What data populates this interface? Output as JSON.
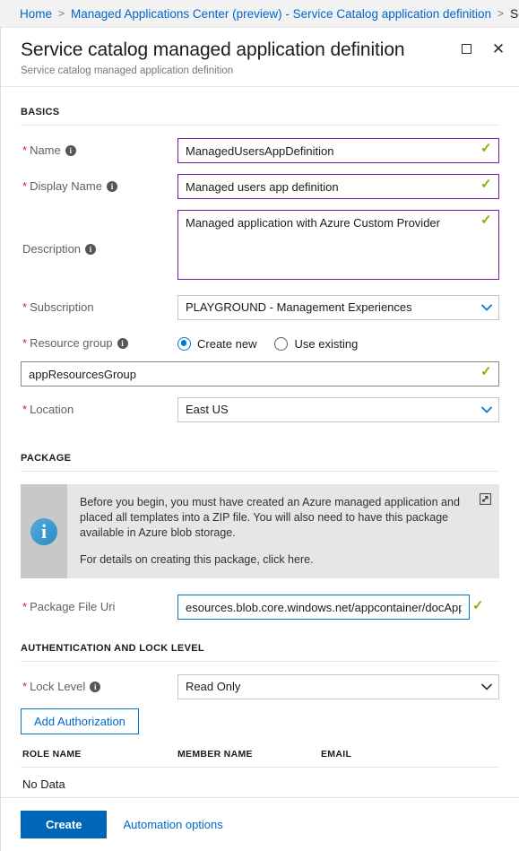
{
  "breadcrumb": {
    "items": [
      {
        "label": "Home"
      },
      {
        "label": "Managed Applications Center (preview) - Service Catalog application definition"
      },
      {
        "label": "Serv"
      }
    ],
    "separator": ">"
  },
  "blade": {
    "title": "Service catalog managed application definition",
    "subtitle": "Service catalog managed application definition",
    "maximize_icon": "maximize-icon",
    "close_icon": "close-icon"
  },
  "sections": {
    "basics": "BASICS",
    "package": "PACKAGE",
    "auth": "AUTHENTICATION AND LOCK LEVEL"
  },
  "fields": {
    "name": {
      "label": "Name",
      "required": "*",
      "value": "ManagedUsersAppDefinition",
      "placeholder": "",
      "valid_icon": "✓"
    },
    "display_name": {
      "label": "Display Name",
      "required": "*",
      "value": "Managed users app definition",
      "placeholder": "",
      "valid_icon": "✓"
    },
    "description": {
      "label": "Description",
      "required": "",
      "value": "Managed application with Azure Custom Provider",
      "placeholder": "",
      "valid_icon": "✓"
    },
    "subscription": {
      "label": "Subscription",
      "required": "*",
      "value": "PLAYGROUND - Management Experiences"
    },
    "resource_group": {
      "label": "Resource group",
      "required": "*",
      "option_create": "Create new",
      "option_existing": "Use existing",
      "selected": "Create new",
      "value": "appResourcesGroup",
      "valid_icon": "✓"
    },
    "location": {
      "label": "Location",
      "required": "*",
      "value": "East US"
    },
    "package_file_uri": {
      "label": "Package File Uri",
      "required": "*",
      "value": "esources.blob.core.windows.net/appcontainer/docApp.zip",
      "valid_icon": "✓"
    },
    "lock_level": {
      "label": "Lock Level",
      "required": "*",
      "value": "Read Only"
    }
  },
  "infobox": {
    "icon": "info-icon",
    "external_link_icon": "external-link-icon",
    "paragraph1": "Before you begin, you must have created an Azure managed application and placed all templates into a ZIP file. You will also need to have this package available in Azure blob storage.",
    "paragraph2": "For details on creating this package, click here."
  },
  "authorization": {
    "add_button": "Add Authorization",
    "columns": [
      "ROLE NAME",
      "MEMBER NAME",
      "EMAIL"
    ],
    "rows": [],
    "empty_text": "No Data"
  },
  "footer": {
    "create_label": "Create",
    "automation_label": "Automation options"
  },
  "colors": {
    "accent": "#0067b8",
    "link": "#0066cc",
    "valid_border": "#7719aa",
    "focus_border": "#0078d4",
    "valid_check": "#7fba00",
    "required_star": "#e81123"
  },
  "info_glyph": "i"
}
